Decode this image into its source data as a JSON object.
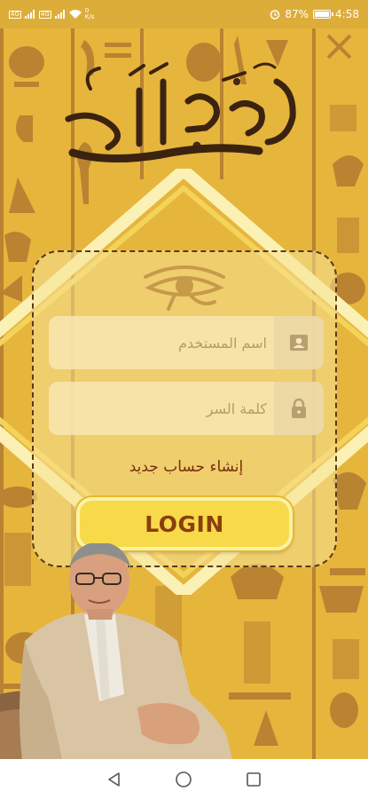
{
  "status_bar": {
    "left_tags": [
      "4G",
      "4G"
    ],
    "net_speed": "0\nK/s",
    "battery": "87%",
    "battery_level": 0.87,
    "time": "4:58"
  },
  "login_form": {
    "username_placeholder": "اسم المستخدم",
    "password_placeholder": "كلمة السر",
    "create_account_link": "إنشاء حساب جديد",
    "login_button": "LOGIN"
  },
  "icons": {
    "username": "person-icon",
    "password": "lock-icon",
    "logo": "calligraphy-logo",
    "eye": "eye-of-horus-icon"
  },
  "colors": {
    "background": "#e6b53c",
    "pattern": "#a6702c",
    "button": "#f7d94a",
    "button_text": "#8a3f0b",
    "link": "#7a2d10"
  }
}
